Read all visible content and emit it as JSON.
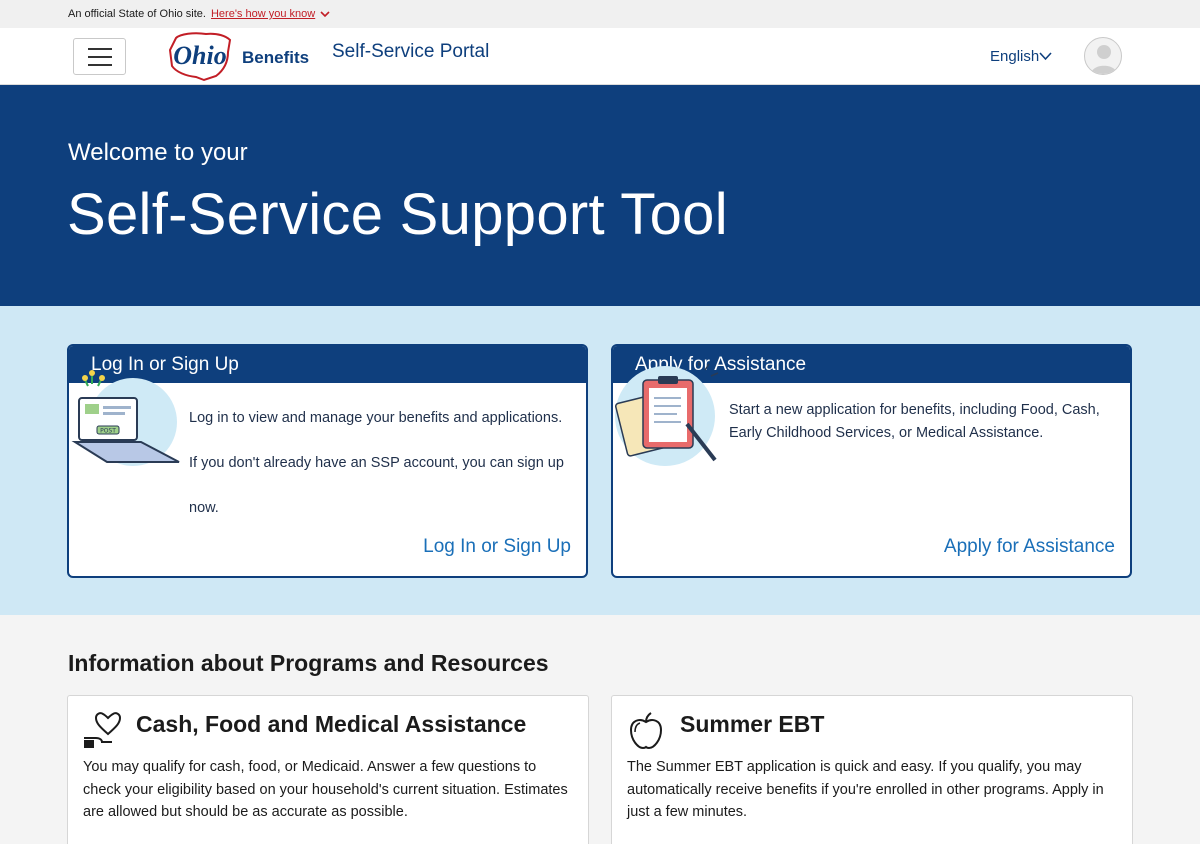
{
  "gov_banner": {
    "text": "An official State of Ohio site.",
    "link": "Here's how you know"
  },
  "header": {
    "logo_word": "Ohio",
    "logo_suffix": "Benefits",
    "portal": "Self-Service Portal",
    "language": "English"
  },
  "hero": {
    "subtitle": "Welcome to your",
    "title": "Self-Service Support Tool"
  },
  "cards": {
    "login": {
      "heading": "Log In or Sign Up",
      "line1": "Log in to view and manage your benefits and applications.",
      "line2": "If you don't already have an SSP account, you can sign up",
      "line3": "now.",
      "link": "Log In or Sign Up",
      "illustration_badge": "POST"
    },
    "apply": {
      "heading": "Apply for Assistance",
      "text": "Start a new application for benefits, including Food, Cash, Early Childhood Services, or Medical Assistance.",
      "link": "Apply for Assistance"
    }
  },
  "info": {
    "heading": "Information about Programs and Resources",
    "programs": [
      {
        "title": "Cash, Food and Medical Assistance",
        "text": "You may qualify for cash, food, or Medicaid. Answer a few questions to check your eligibility based on your household's current situation. Estimates are allowed but should be as accurate as possible.",
        "icon": "heart-hand-icon"
      },
      {
        "title": "Summer EBT",
        "text": "The Summer EBT application is quick and easy. If you qualify, you may automatically receive benefits if you're enrolled in other programs. Apply in just a few minutes.",
        "icon": "apple-icon"
      }
    ]
  },
  "colors": {
    "navy": "#0e3f7d",
    "light_blue": "#cfe8f5",
    "link_blue": "#1a6fb8",
    "ohio_red": "#c21e26"
  }
}
